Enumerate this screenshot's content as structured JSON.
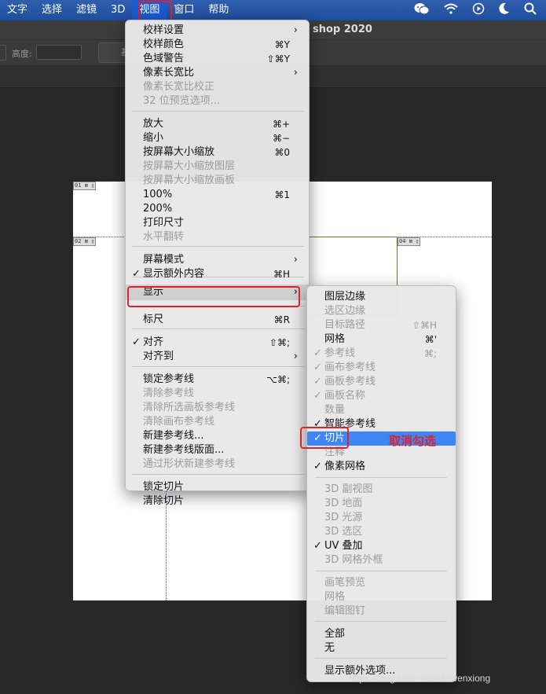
{
  "menubar": {
    "items": [
      "文字",
      "选择",
      "滤镜",
      "3D",
      "视图",
      "窗口",
      "帮助"
    ],
    "active": "视图",
    "status_icons": [
      "wechat-icon",
      "wifi-icon",
      "play-icon",
      "moon-icon",
      "search-icon"
    ]
  },
  "app": {
    "title_fragment": "shop 2020"
  },
  "options_bar": {
    "height_label": "高度:",
    "button_label": "基"
  },
  "canvas": {
    "slice_tags": [
      "01",
      "02",
      "04"
    ]
  },
  "view_menu": {
    "items": [
      {
        "label": "校样设置",
        "shortcut": "",
        "submenu": true,
        "disabled": false,
        "checked": false
      },
      {
        "label": "校样颜色",
        "shortcut": "⌘Y",
        "submenu": false,
        "disabled": false,
        "checked": false
      },
      {
        "label": "色域警告",
        "shortcut": "⇧⌘Y",
        "submenu": false,
        "disabled": false,
        "checked": false
      },
      {
        "label": "像素长宽比",
        "shortcut": "",
        "submenu": true,
        "disabled": false,
        "checked": false
      },
      {
        "label": "像素长宽比校正",
        "shortcut": "",
        "submenu": false,
        "disabled": true,
        "checked": false
      },
      {
        "label": "32 位预览选项...",
        "shortcut": "",
        "submenu": false,
        "disabled": true,
        "checked": false
      },
      {
        "label": "放大",
        "shortcut": "⌘+",
        "submenu": false,
        "disabled": false,
        "checked": false
      },
      {
        "label": "缩小",
        "shortcut": "⌘−",
        "submenu": false,
        "disabled": false,
        "checked": false
      },
      {
        "label": "按屏幕大小缩放",
        "shortcut": "⌘0",
        "submenu": false,
        "disabled": false,
        "checked": false
      },
      {
        "label": "按屏幕大小缩放图层",
        "shortcut": "",
        "submenu": false,
        "disabled": true,
        "checked": false
      },
      {
        "label": "按屏幕大小缩放画板",
        "shortcut": "",
        "submenu": false,
        "disabled": true,
        "checked": false
      },
      {
        "label": "100%",
        "shortcut": "⌘1",
        "submenu": false,
        "disabled": false,
        "checked": false
      },
      {
        "label": "200%",
        "shortcut": "",
        "submenu": false,
        "disabled": false,
        "checked": false
      },
      {
        "label": "打印尺寸",
        "shortcut": "",
        "submenu": false,
        "disabled": false,
        "checked": false
      },
      {
        "label": "水平翻转",
        "shortcut": "",
        "submenu": false,
        "disabled": true,
        "checked": false
      },
      {
        "label": "屏幕模式",
        "shortcut": "",
        "submenu": true,
        "disabled": false,
        "checked": false
      },
      {
        "label": "显示额外内容",
        "shortcut": "⌘H",
        "submenu": false,
        "disabled": false,
        "checked": true
      },
      {
        "label": "显示",
        "shortcut": "",
        "submenu": true,
        "disabled": false,
        "checked": false
      },
      {
        "label": "标尺",
        "shortcut": "⌘R",
        "submenu": false,
        "disabled": false,
        "checked": false
      },
      {
        "label": "对齐",
        "shortcut": "⇧⌘;",
        "submenu": false,
        "disabled": false,
        "checked": true
      },
      {
        "label": "对齐到",
        "shortcut": "",
        "submenu": true,
        "disabled": false,
        "checked": false
      },
      {
        "label": "锁定参考线",
        "shortcut": "⌥⌘;",
        "submenu": false,
        "disabled": false,
        "checked": false
      },
      {
        "label": "清除参考线",
        "shortcut": "",
        "submenu": false,
        "disabled": true,
        "checked": false
      },
      {
        "label": "清除所选画板参考线",
        "shortcut": "",
        "submenu": false,
        "disabled": true,
        "checked": false
      },
      {
        "label": "清除画布参考线",
        "shortcut": "",
        "submenu": false,
        "disabled": true,
        "checked": false
      },
      {
        "label": "新建参考线...",
        "shortcut": "",
        "submenu": false,
        "disabled": false,
        "checked": false
      },
      {
        "label": "新建参考线版面...",
        "shortcut": "",
        "submenu": false,
        "disabled": false,
        "checked": false
      },
      {
        "label": "通过形状新建参考线",
        "shortcut": "",
        "submenu": false,
        "disabled": true,
        "checked": false
      },
      {
        "label": "锁定切片",
        "shortcut": "",
        "submenu": false,
        "disabled": false,
        "checked": false
      },
      {
        "label": "清除切片",
        "shortcut": "",
        "submenu": false,
        "disabled": false,
        "checked": false
      }
    ]
  },
  "show_submenu": {
    "items": [
      {
        "label": "图层边缘",
        "shortcut": "",
        "disabled": false,
        "checked": false
      },
      {
        "label": "选区边缘",
        "shortcut": "",
        "disabled": true,
        "checked": false
      },
      {
        "label": "目标路径",
        "shortcut": "⇧⌘H",
        "disabled": true,
        "checked": false
      },
      {
        "label": "网格",
        "shortcut": "⌘'",
        "disabled": false,
        "checked": false
      },
      {
        "label": "参考线",
        "shortcut": "⌘;",
        "disabled": true,
        "checked": true
      },
      {
        "label": "画布参考线",
        "shortcut": "",
        "disabled": true,
        "checked": true
      },
      {
        "label": "画板参考线",
        "shortcut": "",
        "disabled": true,
        "checked": true
      },
      {
        "label": "画板名称",
        "shortcut": "",
        "disabled": true,
        "checked": true
      },
      {
        "label": "数量",
        "shortcut": "",
        "disabled": true,
        "checked": false
      },
      {
        "label": "智能参考线",
        "shortcut": "",
        "disabled": false,
        "checked": true
      },
      {
        "label": "切片",
        "shortcut": "",
        "disabled": false,
        "checked": true
      },
      {
        "label": "注释",
        "shortcut": "",
        "disabled": true,
        "checked": false
      },
      {
        "label": "像素网格",
        "shortcut": "",
        "disabled": false,
        "checked": true
      },
      {
        "label": "3D 副视图",
        "shortcut": "",
        "disabled": true,
        "checked": false
      },
      {
        "label": "3D 地面",
        "shortcut": "",
        "disabled": true,
        "checked": false
      },
      {
        "label": "3D 光源",
        "shortcut": "",
        "disabled": true,
        "checked": false
      },
      {
        "label": "3D 选区",
        "shortcut": "",
        "disabled": true,
        "checked": false
      },
      {
        "label": "UV 叠加",
        "shortcut": "",
        "disabled": false,
        "checked": true
      },
      {
        "label": "3D 网格外框",
        "shortcut": "",
        "disabled": true,
        "checked": false
      },
      {
        "label": "画笔预览",
        "shortcut": "",
        "disabled": true,
        "checked": false
      },
      {
        "label": "网格",
        "shortcut": "",
        "disabled": true,
        "checked": false
      },
      {
        "label": "编辑图钉",
        "shortcut": "",
        "disabled": true,
        "checked": false
      },
      {
        "label": "全部",
        "shortcut": "",
        "disabled": false,
        "checked": false
      },
      {
        "label": "无",
        "shortcut": "",
        "disabled": false,
        "checked": false
      },
      {
        "label": "显示额外选项...",
        "shortcut": "",
        "disabled": false,
        "checked": false
      }
    ]
  },
  "annotation": "取消勾选",
  "watermark": "https://blog.csdn.net/liaowenxiong"
}
